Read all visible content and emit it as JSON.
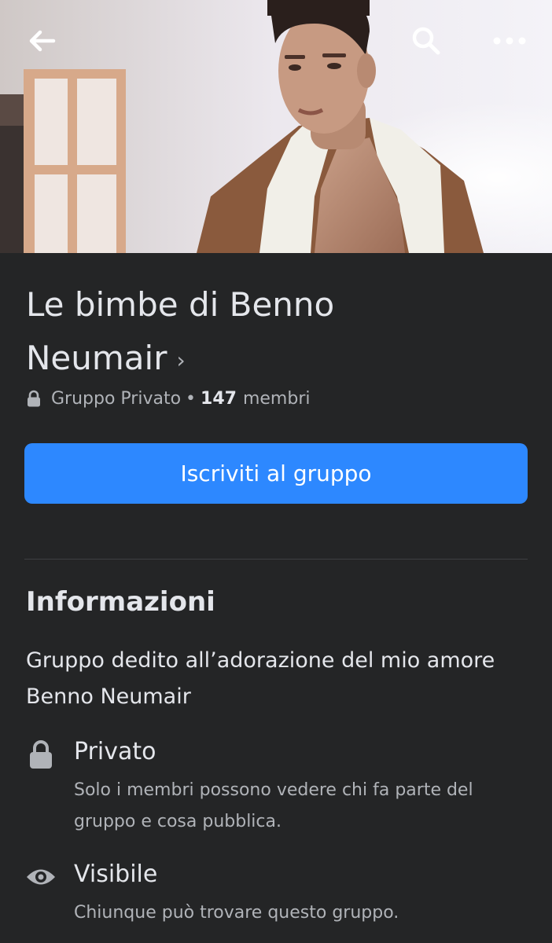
{
  "topbar": {
    "back_icon": "arrow-left-icon",
    "search_icon": "search-icon",
    "more_icon": "more-horizontal-icon"
  },
  "group": {
    "title": "Le bimbe di Benno Neumair",
    "title_chevron": "›",
    "privacy_label": "Gruppo Privato",
    "separator": "•",
    "member_count": "147",
    "members_label": "membri"
  },
  "join_button": {
    "label": "Iscriviti al gruppo"
  },
  "about": {
    "heading": "Informazioni",
    "description": "Gruppo dedito all’adorazione del mio amore Benno Neumair",
    "items": [
      {
        "icon": "lock-icon",
        "label": "Privato",
        "description": "Solo i membri possono vedere chi fa parte del gruppo e cosa pubblica."
      },
      {
        "icon": "eye-icon",
        "label": "Visibile",
        "description": "Chiunque può trovare questo gruppo."
      }
    ]
  },
  "colors": {
    "background": "#242526",
    "primary_button": "#2d88ff",
    "text_primary": "#e4e6eb",
    "text_secondary": "#b0b3b8",
    "divider": "#3e4042"
  }
}
